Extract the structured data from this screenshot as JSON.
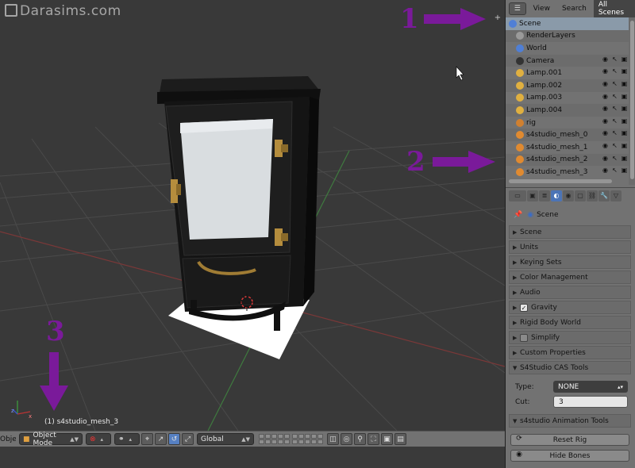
{
  "viewport": {
    "watermark": "Darasims.com",
    "object_label": "(1) s4studio_mesh_3",
    "markers": [
      "1",
      "2",
      "3"
    ]
  },
  "bottom_bar": {
    "editor_label": "Object",
    "mode": "Object Mode",
    "orientation": "Global"
  },
  "outliner": {
    "tabs": [
      "View",
      "Search",
      "All Scenes"
    ],
    "active_tab": "All Scenes",
    "rows": [
      {
        "label": "Scene",
        "icon": "scene-icon",
        "indent": 0,
        "selected": true
      },
      {
        "label": "RenderLayers",
        "icon": "renderlayers-icon",
        "indent": 1
      },
      {
        "label": "World",
        "icon": "world-icon",
        "indent": 1
      },
      {
        "label": "Camera",
        "icon": "camera-icon",
        "indent": 1
      },
      {
        "label": "Lamp.001",
        "icon": "lamp-icon",
        "indent": 1
      },
      {
        "label": "Lamp.002",
        "icon": "lamp-icon",
        "indent": 1
      },
      {
        "label": "Lamp.003",
        "icon": "lamp-icon",
        "indent": 1
      },
      {
        "label": "Lamp.004",
        "icon": "lamp-icon",
        "indent": 1
      },
      {
        "label": "rig",
        "icon": "armature-icon",
        "indent": 1
      },
      {
        "label": "s4studio_mesh_0",
        "icon": "mesh-icon",
        "indent": 1
      },
      {
        "label": "s4studio_mesh_1",
        "icon": "mesh-icon",
        "indent": 1
      },
      {
        "label": "s4studio_mesh_2",
        "icon": "mesh-icon",
        "indent": 1
      },
      {
        "label": "s4studio_mesh_3",
        "icon": "mesh-icon",
        "indent": 1
      }
    ]
  },
  "properties": {
    "context": "Scene",
    "panels": [
      {
        "label": "Scene",
        "open": false
      },
      {
        "label": "Units",
        "open": false
      },
      {
        "label": "Keying Sets",
        "open": false
      },
      {
        "label": "Color Management",
        "open": false
      },
      {
        "label": "Audio",
        "open": false
      },
      {
        "label": "Gravity",
        "open": false,
        "checkbox": true,
        "checked": true
      },
      {
        "label": "Rigid Body World",
        "open": false
      },
      {
        "label": "Simplify",
        "open": false,
        "checkbox": true,
        "checked": false
      },
      {
        "label": "Custom Properties",
        "open": false
      }
    ],
    "cas_tools": {
      "title": "S4Studio CAS Tools",
      "type_label": "Type:",
      "type_value": "NONE",
      "cut_label": "Cut:",
      "cut_value": "3"
    },
    "anim_tools": {
      "title": "s4studio Animation Tools",
      "reset_rig": "Reset Rig",
      "hide_bones": "Hide Bones"
    }
  },
  "colors": {
    "marker": "#7a1a9a",
    "selection": "#5680c2",
    "viewport_bg": "#393939"
  }
}
